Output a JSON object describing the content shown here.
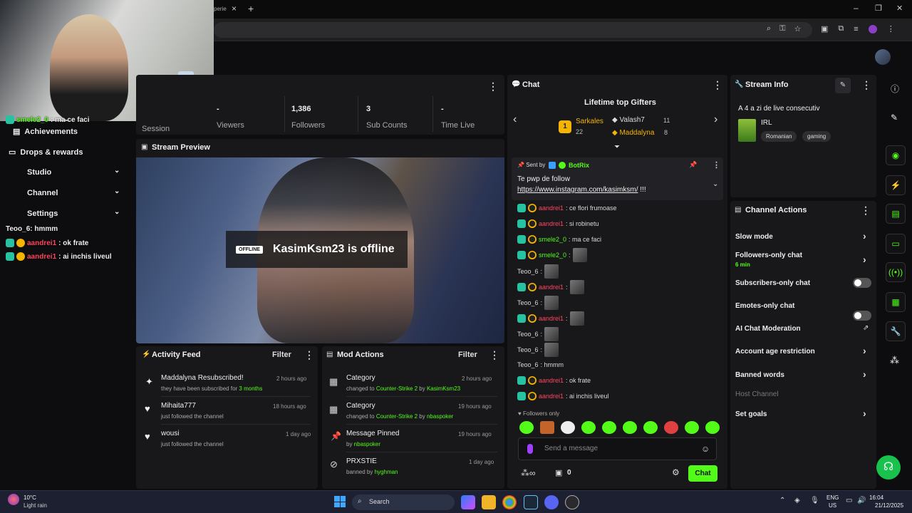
{
  "browser": {
    "tab_partial": "perie",
    "close_tab": "×",
    "new_tab": "+",
    "window_controls": [
      "–",
      "❐",
      "✕"
    ]
  },
  "stats": {
    "session_label": "Session",
    "viewers_value": "-",
    "viewers_label": "Viewers",
    "followers_value": "1,386",
    "followers_label": "Followers",
    "subs_value": "3",
    "subs_label": "Sub Counts",
    "time_value": "-",
    "time_label": "Time Live"
  },
  "preview": {
    "title": "Stream Preview",
    "offline_badge": "OFFLINE",
    "offline_text": "KasimKsm23 is offline"
  },
  "activity_feed": {
    "title": "Activity Feed",
    "filter": "Filter",
    "items": [
      {
        "title": "Maddalyna Resubscribed!",
        "sub_prefix": "they have been subscribed for ",
        "sub_highlight": "3 months",
        "time": "2 hours ago",
        "icon": "star-icon"
      },
      {
        "title": "Mihaita777",
        "sub_prefix": "just followed the channel",
        "sub_highlight": "",
        "time": "18 hours ago",
        "icon": "heart-icon"
      },
      {
        "title": "wousi",
        "sub_prefix": "just followed the channel",
        "sub_highlight": "",
        "time": "1 day ago",
        "icon": "heart-icon"
      }
    ]
  },
  "mod_actions": {
    "title": "Mod Actions",
    "filter": "Filter",
    "items": [
      {
        "title": "Category",
        "line_prefix": "changed to ",
        "target": "Counter-Strike 2",
        "by_word": " by ",
        "actor": "KasimKsm23",
        "time": "2 hours ago",
        "icon": "category-icon"
      },
      {
        "title": "Category",
        "line_prefix": "changed to ",
        "target": "Counter-Strike 2",
        "by_word": " by ",
        "actor": "nbaspoker",
        "time": "19 hours ago",
        "icon": "category-icon"
      },
      {
        "title": "Message Pinned",
        "line_prefix": "by ",
        "target": "",
        "by_word": "",
        "actor": "nbaspoker",
        "time": "19 hours ago",
        "icon": "pin-icon"
      },
      {
        "title": "PRXSTIE",
        "line_prefix": "banned by ",
        "target": "",
        "by_word": "",
        "actor": "hyghman",
        "time": "1 day ago",
        "icon": "ban-icon"
      }
    ]
  },
  "chat": {
    "title": "Chat",
    "gifters_title": "Lifetime top Gifters",
    "gifter1_rank": "1",
    "gifter1_name": "Sarkales",
    "gifter1_count": "22",
    "gifter2_name": "Valash7",
    "gifter2_count": "11",
    "gifter3_name": "Maddalyna",
    "gifter3_count": "8",
    "pinned_label": "Sent by",
    "pinned_author": "BotRix",
    "pinned_line1": "Te pwp de follow",
    "pinned_link": "https://www.instagram.com/kasimksm/",
    "pinned_bang": " !!!",
    "messages": [
      {
        "user": "aandrei1",
        "text": ": ce flori frumoase",
        "color": "red",
        "badges": true
      },
      {
        "user": "aandrei1",
        "text": ": si robinetu",
        "color": "red",
        "badges": true
      },
      {
        "user": "smele2_0",
        "text": ": ma ce faci",
        "color": "grn",
        "badges": true
      },
      {
        "user": "smele2_0",
        "text": ":",
        "color": "grn",
        "badges": true,
        "emote": true
      },
      {
        "user": "Teoo_6",
        "text": ":",
        "color": "gry",
        "badges": false,
        "emote": true
      },
      {
        "user": "aandrei1",
        "text": ":",
        "color": "red",
        "badges": true,
        "emote": true
      },
      {
        "user": "Teoo_6",
        "text": ":",
        "color": "gry",
        "badges": false,
        "emote": true
      },
      {
        "user": "aandrei1",
        "text": ":",
        "color": "red",
        "badges": true,
        "emote": true
      },
      {
        "user": "Teoo_6",
        "text": ":",
        "color": "gry",
        "badges": false,
        "emote": true
      },
      {
        "user": "Teoo_6",
        "text": ":",
        "color": "gry",
        "badges": false,
        "emote": true
      },
      {
        "user": "Teoo_6",
        "text": ": hmmm",
        "color": "gry",
        "badges": false
      },
      {
        "user": "aandrei1",
        "text": ": ok frate",
        "color": "red",
        "badges": true
      },
      {
        "user": "aandrei1",
        "text": ": ai inchis liveul",
        "color": "red",
        "badges": true
      }
    ],
    "followers_only": "Followers only",
    "input_placeholder": "Send a message",
    "points": "0",
    "send_button": "Chat"
  },
  "stream_info": {
    "title": "Stream Info",
    "stream_title": "A 4 a zi de live consecutiv",
    "category": "IRL",
    "tags": [
      "Romanian",
      "gaming"
    ]
  },
  "channel_actions": {
    "title": "Channel Actions",
    "items": [
      {
        "label": "Slow mode",
        "kind": "chevron"
      },
      {
        "label": "Followers-only chat",
        "sub": "6 min",
        "kind": "chevron"
      },
      {
        "label": "Subscribers-only chat",
        "kind": "toggle"
      },
      {
        "label": "Emotes-only chat",
        "kind": "toggle"
      },
      {
        "label": "AI Chat Moderation",
        "kind": "external"
      },
      {
        "label": "Account age restriction",
        "kind": "chevron"
      },
      {
        "label": "Banned words",
        "kind": "chevron"
      },
      {
        "label": "Host Channel",
        "kind": "disabled"
      },
      {
        "label": "Set goals",
        "kind": "chevron"
      }
    ]
  },
  "overlay_left": {
    "lines": [
      {
        "user": "smele2_0",
        "text": ": ma ce faci"
      },
      {
        "user": "Achievements",
        "text": ""
      },
      {
        "user": "Drops & rewards",
        "text": ""
      },
      {
        "user": "Studio",
        "text": ""
      },
      {
        "user": "Channel",
        "text": ""
      },
      {
        "user": "Settings",
        "text": ""
      },
      {
        "user": "Teoo_6",
        "text": ": hmmm"
      },
      {
        "user": "aandrei1",
        "text": ": ok frate"
      },
      {
        "user": "aandrei1",
        "text": ": ai inchis liveul"
      }
    ]
  },
  "taskbar": {
    "weather_temp": "10°C",
    "weather_desc": "Light rain",
    "search": "Search",
    "lang1": "ENG",
    "lang2": "US",
    "time": "16:04",
    "date": "21/12/2025"
  }
}
